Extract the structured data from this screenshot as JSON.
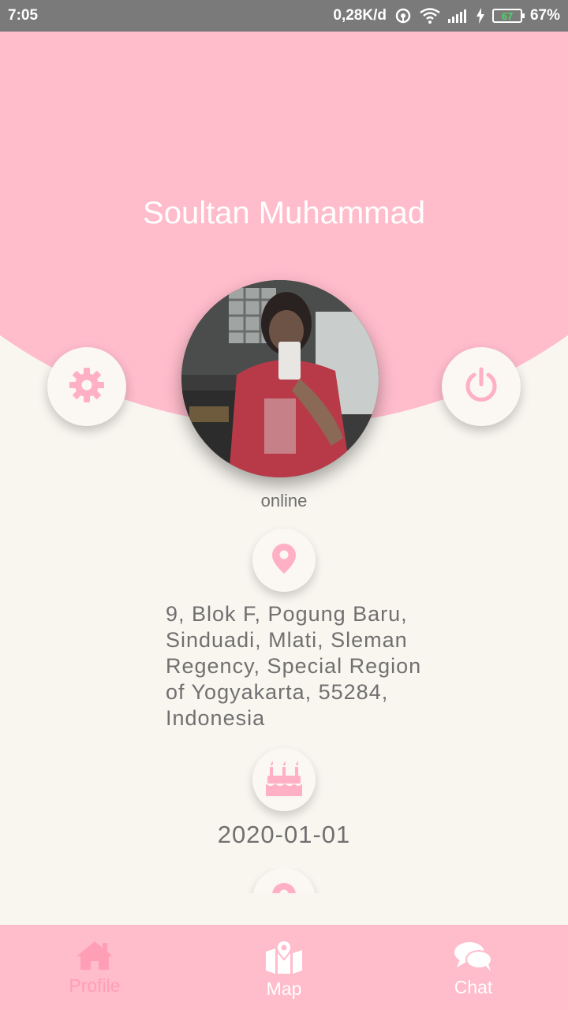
{
  "status_bar": {
    "time": "7:05",
    "network_speed": "0,28K/d",
    "battery_level": "67",
    "battery_percent": "67%"
  },
  "profile": {
    "name": "Soultan Muhammad",
    "status": "online",
    "address": "9, Blok F, Pogung Baru,\nSinduadi, Mlati, Sleman\nRegency, Special Region\nof Yogyakarta, 55284,\nIndonesia",
    "birthdate": "2020-01-01"
  },
  "icons": {
    "settings": "gear-icon",
    "logout": "power-icon",
    "location": "map-pin-icon",
    "birthday": "cake-icon"
  },
  "bottom_nav": {
    "items": [
      {
        "label": "Profile",
        "icon": "home-icon",
        "active": true
      },
      {
        "label": "Map",
        "icon": "map-icon",
        "active": false
      },
      {
        "label": "Chat",
        "icon": "chat-icon",
        "active": false
      }
    ]
  },
  "colors": {
    "primary_pink": "#ffbccb",
    "icon_pink": "#ffb0c4",
    "background": "#f9f6f0",
    "text_gray": "#707070"
  }
}
